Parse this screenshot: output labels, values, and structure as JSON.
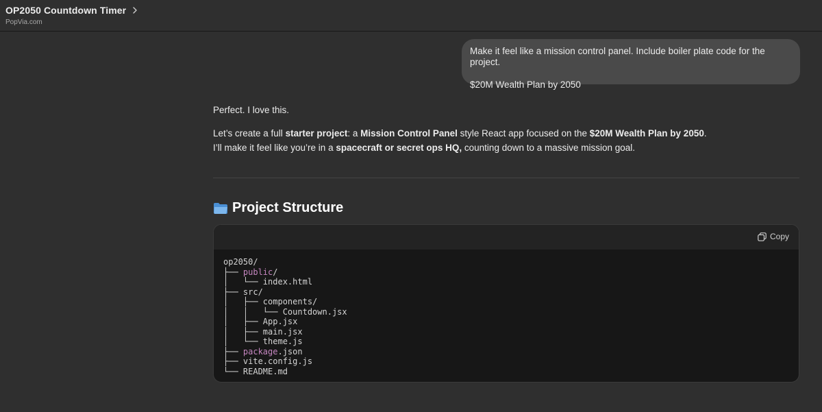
{
  "header": {
    "title": "OP2050 Countdown Timer",
    "subtitle": "PopVia.com"
  },
  "user_message": {
    "line1": "Make it feel like a mission control panel. Include boiler plate code for the project.",
    "line2": "$20M Wealth Plan by 2050"
  },
  "assistant": {
    "p1": "Perfect. I love this.",
    "p2": {
      "t1": "Let’s create a full ",
      "b1": "starter project",
      "t2": ": a ",
      "b2": "Mission Control Panel",
      "t3": " style React app focused on the ",
      "b3": "$20M Wealth Plan by 2050",
      "t4": ".",
      "t5": "I’ll make it feel like you’re in a ",
      "b4": "spacecraft or secret ops HQ,",
      "t6": " counting down to a massive mission goal."
    },
    "section_title": "Project Structure"
  },
  "code_block": {
    "copy_label": "Copy",
    "lines": [
      {
        "pre": "op2050/",
        "kw": "",
        "post": ""
      },
      {
        "pre": "├── ",
        "kw": "public",
        "post": "/"
      },
      {
        "pre": "│   └── index.html",
        "kw": "",
        "post": ""
      },
      {
        "pre": "├── src/",
        "kw": "",
        "post": ""
      },
      {
        "pre": "│   ├── components/",
        "kw": "",
        "post": ""
      },
      {
        "pre": "│   │   └── Countdown.jsx",
        "kw": "",
        "post": ""
      },
      {
        "pre": "│   ├── App.jsx",
        "kw": "",
        "post": ""
      },
      {
        "pre": "│   ├── main.jsx",
        "kw": "",
        "post": ""
      },
      {
        "pre": "│   └── theme.js",
        "kw": "",
        "post": ""
      },
      {
        "pre": "├── ",
        "kw": "package",
        "post": ".json"
      },
      {
        "pre": "├── vite.config.js",
        "kw": "",
        "post": ""
      },
      {
        "pre": "└── README.md",
        "kw": "",
        "post": ""
      }
    ]
  },
  "colors": {
    "background": "#2f2f2f",
    "user_bubble": "#4a4a4a",
    "code_bg": "#171717",
    "keyword": "#c586c0"
  },
  "icons": [
    "chevron-right-icon",
    "folder-icon",
    "copy-icon"
  ]
}
